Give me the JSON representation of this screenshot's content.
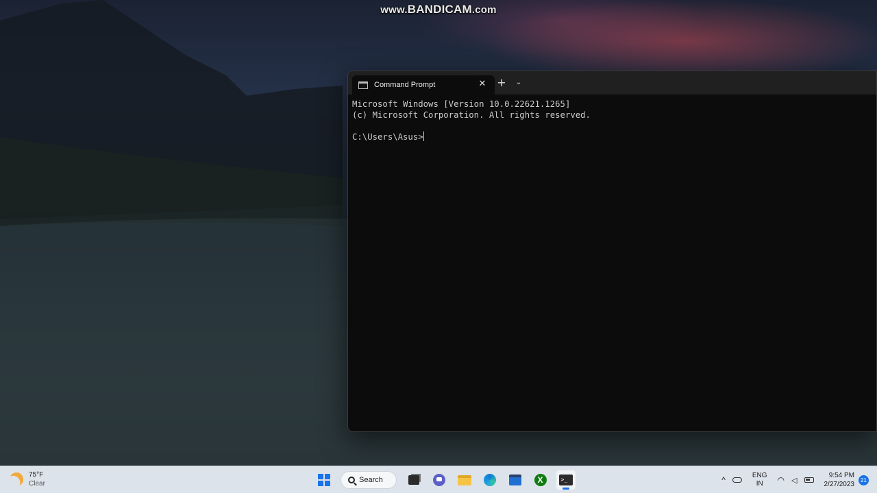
{
  "watermark": {
    "prefix": "www.",
    "brand": "BANDICAM",
    "suffix": ".com"
  },
  "terminal": {
    "tab_title": "Command Prompt",
    "close_glyph": "✕",
    "new_tab_glyph": "+",
    "dropdown_glyph": "⌄",
    "lines": [
      "Microsoft Windows [Version 10.0.22621.1265]",
      "(c) Microsoft Corporation. All rights reserved.",
      "",
      "C:\\Users\\Asus>"
    ]
  },
  "taskbar": {
    "weather": {
      "temp": "75°F",
      "condition": "Clear",
      "icon": "moon-icon"
    },
    "search_label": "Search",
    "apps": [
      {
        "name": "start-icon"
      },
      {
        "name": "task-view-icon"
      },
      {
        "name": "chat-icon"
      },
      {
        "name": "file-explorer-icon"
      },
      {
        "name": "edge-icon"
      },
      {
        "name": "store-icon"
      },
      {
        "name": "xbox-icon",
        "glyph": "X"
      },
      {
        "name": "terminal-icon",
        "glyph": ">_",
        "active": true
      }
    ],
    "tray": {
      "chevron": "^",
      "lang_top": "ENG",
      "lang_bottom": "IN",
      "time": "9:54 PM",
      "date": "2/27/2023",
      "notifications": "21"
    },
    "accent": "#1a73e8"
  }
}
